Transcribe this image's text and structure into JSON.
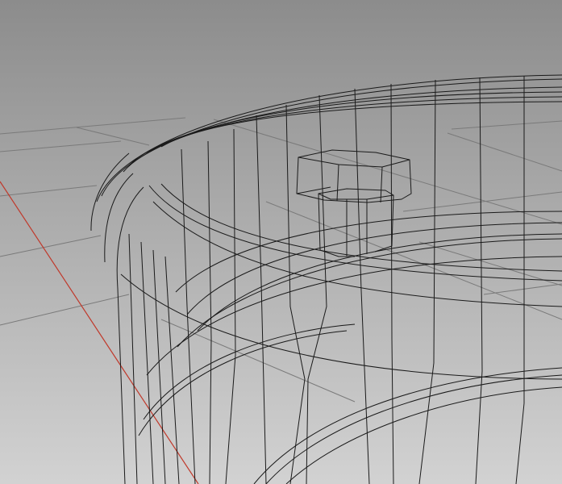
{
  "viewport": {
    "view": "perspective",
    "display_mode": "wireframe",
    "background_top_color": "#8c8c8c",
    "background_bottom_color": "#d2d2d2",
    "grid_color": "#7a7a7a",
    "x_axis_color": "#c0392b",
    "wire_color": "#1a1a1a",
    "model": {
      "parts": [
        "cylindrical-container",
        "inner-rim-ring",
        "lower-ring",
        "hexagonal-bolt"
      ]
    }
  }
}
